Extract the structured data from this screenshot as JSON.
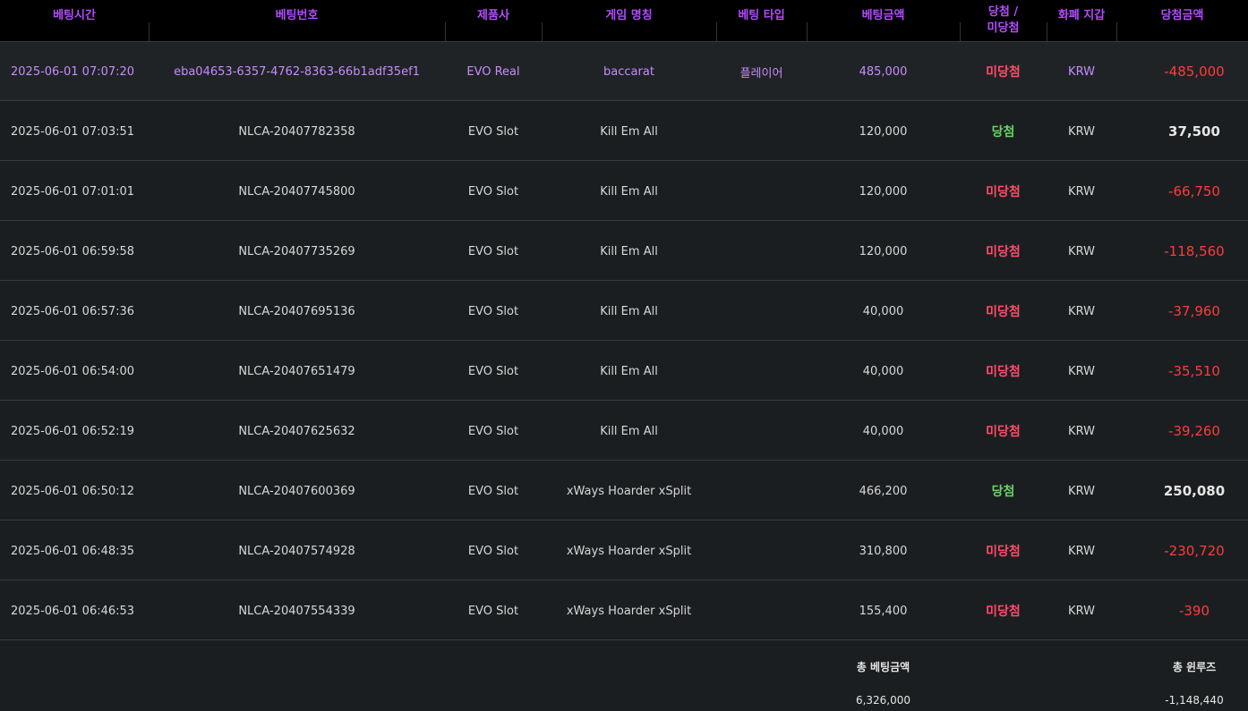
{
  "columns": [
    "베팅시간",
    "베팅번호",
    "제품사",
    "게임 명칭",
    "베팅 타입",
    "베팅금액",
    "당첨 /",
    "미당첨",
    "화폐 지갑",
    "당첨금액"
  ],
  "rows": [
    {
      "time": "2025-06-01 07:07:20",
      "id": "eba04653-6357-4762-8363-66b1adf35ef1",
      "provider": "EVO Real",
      "game": "baccarat",
      "bet_type": "플레이어",
      "bet": "485,000",
      "status": "미당첨",
      "currency": "KRW",
      "win": "-485,000"
    },
    {
      "time": "2025-06-01 07:03:51",
      "id": "NLCA-20407782358",
      "provider": "EVO Slot",
      "game": "Kill Em All",
      "bet_type": "",
      "bet": "120,000",
      "status": "당첨",
      "currency": "KRW",
      "win": "37,500"
    },
    {
      "time": "2025-06-01 07:01:01",
      "id": "NLCA-20407745800",
      "provider": "EVO Slot",
      "game": "Kill Em All",
      "bet_type": "",
      "bet": "120,000",
      "status": "미당첨",
      "currency": "KRW",
      "win": "-66,750"
    },
    {
      "time": "2025-06-01 06:59:58",
      "id": "NLCA-20407735269",
      "provider": "EVO Slot",
      "game": "Kill Em All",
      "bet_type": "",
      "bet": "120,000",
      "status": "미당첨",
      "currency": "KRW",
      "win": "-118,560"
    },
    {
      "time": "2025-06-01 06:57:36",
      "id": "NLCA-20407695136",
      "provider": "EVO Slot",
      "game": "Kill Em All",
      "bet_type": "",
      "bet": "40,000",
      "status": "미당첨",
      "currency": "KRW",
      "win": "-37,960"
    },
    {
      "time": "2025-06-01 06:54:00",
      "id": "NLCA-20407651479",
      "provider": "EVO Slot",
      "game": "Kill Em All",
      "bet_type": "",
      "bet": "40,000",
      "status": "미당첨",
      "currency": "KRW",
      "win": "-35,510"
    },
    {
      "time": "2025-06-01 06:52:19",
      "id": "NLCA-20407625632",
      "provider": "EVO Slot",
      "game": "Kill Em All",
      "bet_type": "",
      "bet": "40,000",
      "status": "미당첨",
      "currency": "KRW",
      "win": "-39,260"
    },
    {
      "time": "2025-06-01 06:50:12",
      "id": "NLCA-20407600369",
      "provider": "EVO Slot",
      "game": "xWays Hoarder xSplit",
      "bet_type": "",
      "bet": "466,200",
      "status": "당첨",
      "currency": "KRW",
      "win": "250,080"
    },
    {
      "time": "2025-06-01 06:48:35",
      "id": "NLCA-20407574928",
      "provider": "EVO Slot",
      "game": "xWays Hoarder xSplit",
      "bet_type": "",
      "bet": "310,800",
      "status": "미당첨",
      "currency": "KRW",
      "win": "-230,720"
    },
    {
      "time": "2025-06-01 06:46:53",
      "id": "NLCA-20407554339",
      "provider": "EVO Slot",
      "game": "xWays Hoarder xSplit",
      "bet_type": "",
      "bet": "155,400",
      "status": "미당첨",
      "currency": "KRW",
      "win": "-390"
    }
  ],
  "footer": {
    "total_bet_label": "총 베팅금액",
    "total_bet_value": "6,326,000",
    "total_winloss_label": "총 윈루즈",
    "total_winloss_value": "-1,148,440"
  },
  "colors": {
    "header_text": "#b44bff",
    "win": "#64d564",
    "lose": "#ff4b6b",
    "negative_amount": "#ff3b3b"
  }
}
